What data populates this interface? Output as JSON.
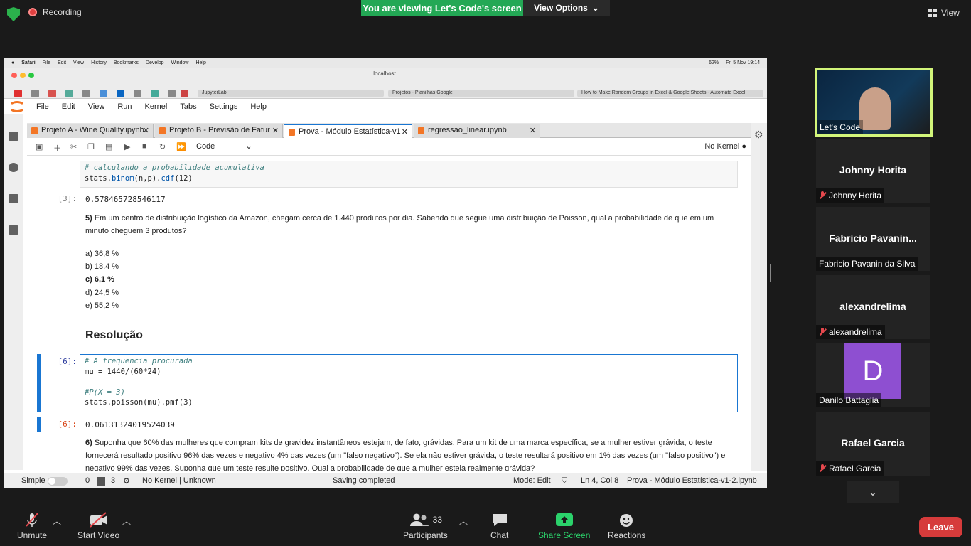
{
  "zoom": {
    "recording_label": "Recording",
    "viewing_banner": "You are viewing Let's Code's screen",
    "view_options": "View Options",
    "view_button": "View",
    "bottom": {
      "unmute": "Unmute",
      "start_video": "Start Video",
      "participants": "Participants",
      "participants_count": "33",
      "chat": "Chat",
      "share_screen": "Share Screen",
      "reactions": "Reactions",
      "leave": "Leave"
    },
    "gallery": [
      {
        "label": "Let's Code"
      },
      {
        "name": "Johnny Horita",
        "label": "Johnny Horita"
      },
      {
        "name": "Fabricio  Pavanin...",
        "label": "Fabricio Pavanin da Silva"
      },
      {
        "name": "alexandrelima",
        "label": "alexandrelima"
      },
      {
        "avatar": "D",
        "label": "Danilo Battaglia"
      },
      {
        "name": "Rafael Garcia",
        "label": "Rafael Garcia"
      }
    ]
  },
  "mac": {
    "menu": [
      "Safari",
      "File",
      "Edit",
      "View",
      "History",
      "Bookmarks",
      "Develop",
      "Window",
      "Help"
    ],
    "battery": "62%",
    "clock": "Fri 5 Nov  19:14"
  },
  "safari": {
    "url": "localhost",
    "tabs": [
      "JupyterLab",
      "Projetos - Planilhas Google",
      "How to Make Random Groups in Excel & Google Sheets - Automate Excel"
    ]
  },
  "jupyter": {
    "menu": [
      "File",
      "Edit",
      "View",
      "Run",
      "Kernel",
      "Tabs",
      "Settings",
      "Help"
    ],
    "tabs": [
      "Projeto A - Wine Quality.ipynb",
      "Projeto B - Previsão de Fatur",
      "Prova - Módulo Estatística-v1",
      "regressao_linear.ipynb"
    ],
    "cell_type": "Code",
    "kernel": "No Kernel",
    "cells": {
      "c1_line1": "# calculando a probabilidade acumulativa",
      "c1_line2a": "stats.",
      "c1_line2b": "binom",
      "c1_line2c": "(n,p).",
      "c1_line2d": "cdf",
      "c1_line2e": "(12)",
      "p3": "[3]:",
      "out3": "0.578465728546117",
      "q5_num": "5)",
      "q5_text": "Em um centro de distribuição logístico da Amazon, chegam cerca de 1.440 produtos por dia. Sabendo que segue uma distribuição de Poisson, qual a probabilidade de que em um minuto cheguem 3 produtos?",
      "opt_a": "a) 36,8 %",
      "opt_b": "b) 18,4 %",
      "opt_c": "c) 6,1 %",
      "opt_d": "d) 24,5 %",
      "opt_e": "e) 55,2 %",
      "heading": "Resolução",
      "p6": "[6]:",
      "c2_line1": "# A frequencia procurada",
      "c2_line2": "mu = 1440/(60*24)",
      "c2_line4": "#P(X = 3)",
      "c2_line5": "stats.poisson(mu).pmf(3)",
      "out6": "0.06131324019524039",
      "q6_num": "6)",
      "q6_text": "Suponha que 60% das mulheres que compram kits de gravidez instantâneos estejam, de fato, grávidas. Para um kit de uma marca específica, se a mulher estiver grávida, o teste fornecerá resultado positivo 96% das vezes e negativo 4% das vezes (um \"falso negativo\"). Se ela não estiver grávida, o teste resultará positivo em 1% das vezes (um \"falso positivo\") e negativo 99% das vezes. Suponha que um teste resulte positivo. Qual a probabilidade de que a mulher esteja realmente grávida?"
    },
    "status": {
      "simple": "Simple",
      "zero": "0",
      "three": "3",
      "kernel": "No Kernel | Unknown",
      "saving": "Saving completed",
      "mode": "Mode: Edit",
      "position": "Ln 4, Col 8",
      "file": "Prova - Módulo Estatística-v1-2.ipynb"
    }
  }
}
